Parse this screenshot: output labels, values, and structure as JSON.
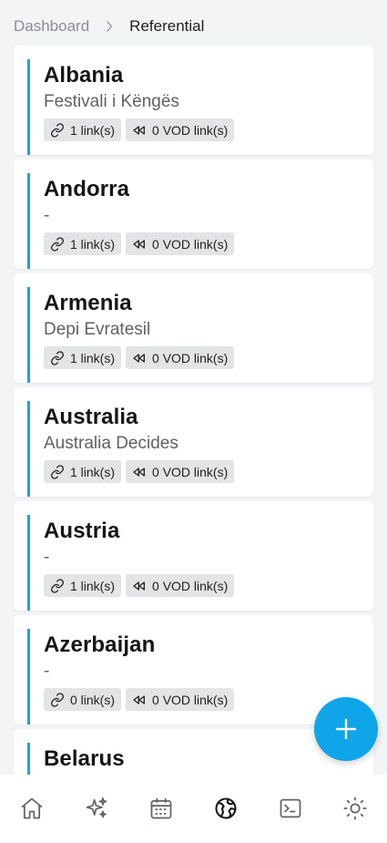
{
  "breadcrumb": {
    "parent": "Dashboard",
    "current": "Referential"
  },
  "countries": [
    {
      "name": "Albania",
      "subtitle": "Festivali i Këngës",
      "links": "1 link(s)",
      "vod": "0 VOD link(s)"
    },
    {
      "name": "Andorra",
      "subtitle": "-",
      "links": "1 link(s)",
      "vod": "0 VOD link(s)"
    },
    {
      "name": "Armenia",
      "subtitle": "Depi Evratesil",
      "links": "1 link(s)",
      "vod": "0 VOD link(s)"
    },
    {
      "name": "Australia",
      "subtitle": "Australia Decides",
      "links": "1 link(s)",
      "vod": "0 VOD link(s)"
    },
    {
      "name": "Austria",
      "subtitle": "-",
      "links": "1 link(s)",
      "vod": "0 VOD link(s)"
    },
    {
      "name": "Azerbaijan",
      "subtitle": "-",
      "links": "0 link(s)",
      "vod": "0 VOD link(s)"
    },
    {
      "name": "Belarus",
      "subtitle": "",
      "links": "",
      "vod": ""
    }
  ],
  "icons": {
    "link": "link-icon",
    "vod": "rewind-icon",
    "fab": "plus-icon",
    "nav": [
      "home-icon",
      "sparkles-icon",
      "calendar-icon",
      "globe-icon",
      "terminal-icon",
      "sun-icon"
    ]
  },
  "colors": {
    "accent": "#1aa1e6",
    "fab": "#0ea5e9",
    "background": "#f3f4f6"
  }
}
